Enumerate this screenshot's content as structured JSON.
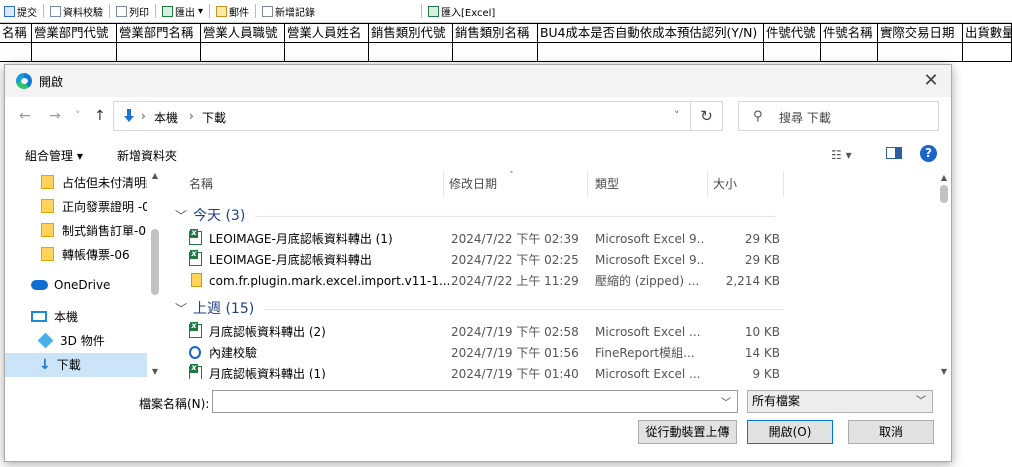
{
  "toolbar": {
    "items": [
      "提交",
      "資料校驗",
      "列印",
      "匯出",
      "郵件",
      "新增記錄",
      "匯入[Excel]"
    ]
  },
  "grid": {
    "columns": [
      "名稱",
      "營業部門代號",
      "營業部門名稱",
      "營業人員職號",
      "營業人員姓名",
      "銷售類別代號",
      "銷售類別名稱",
      "BU4成本是否自動依成本預估認列(Y/N)",
      "件號代號",
      "件號名稱",
      "實際交易日期",
      "出貨數量"
    ]
  },
  "dialog": {
    "title": "開啟",
    "close": "✕",
    "nav": {
      "back": "←",
      "forward": "→",
      "recent": "˅",
      "up": "↑"
    },
    "address": {
      "crumbs": [
        "本機",
        "下載"
      ],
      "separator": "›",
      "dropdown": "˅"
    },
    "refresh": "↻",
    "search": {
      "placeholder": "搜尋 下載"
    },
    "commands": {
      "organize": "組合管理 ▾",
      "new_folder": "新增資料夾",
      "view": "☷ ▾",
      "help": "?"
    },
    "nav_pane": {
      "items": [
        "占估但未付清明細",
        "正向發票證明 -0",
        "制式銷售訂單-0",
        "轉帳傳票-06",
        "OneDrive",
        "本機",
        "3D 物件",
        "下載"
      ]
    },
    "columns": {
      "name": "名稱",
      "date": "修改日期",
      "type": "類型",
      "size": "大小"
    },
    "groups": [
      {
        "label": "今天 (3)",
        "files": [
          {
            "name": "LEOIMAGE-月底認帳資料轉出 (1)",
            "date": "2024/7/22 下午 02:39",
            "type": "Microsoft Excel 9...",
            "size": "29 KB",
            "icon": "excel-icon"
          },
          {
            "name": "LEOIMAGE-月底認帳資料轉出",
            "date": "2024/7/22 下午 02:25",
            "type": "Microsoft Excel 9...",
            "size": "29 KB",
            "icon": "excel-icon"
          },
          {
            "name": "com.fr.plugin.mark.excel.import.v11-1....",
            "date": "2024/7/22 上午 11:29",
            "type": "壓縮的 (zipped) ...",
            "size": "2,214 KB",
            "icon": "zip-icon"
          }
        ]
      },
      {
        "label": "上週 (15)",
        "files": [
          {
            "name": "月底認帳資料轉出 (2)",
            "date": "2024/7/19 下午 02:58",
            "type": "Microsoft Excel ...",
            "size": "10 KB",
            "icon": "excel-icon"
          },
          {
            "name": "內建校驗",
            "date": "2024/7/19 下午 01:56",
            "type": "FineReport模組...",
            "size": "14 KB",
            "icon": "finereport-icon"
          },
          {
            "name": "月底認帳資料轉出 (1)",
            "date": "2024/7/19 下午 01:40",
            "type": "Microsoft Excel ...",
            "size": "9 KB",
            "icon": "excel-icon"
          }
        ]
      }
    ],
    "filename": {
      "label": "檔案名稱(N):",
      "value": ""
    },
    "filetype": {
      "value": "所有檔案"
    },
    "buttons": {
      "upload": "從行動裝置上傳",
      "open": "開啟(O)",
      "cancel": "取消"
    }
  }
}
